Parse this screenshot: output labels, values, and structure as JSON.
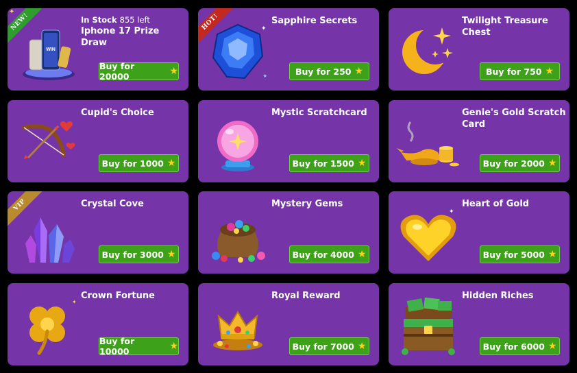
{
  "star_glyph": "★",
  "colors": {
    "card": "#7535a8",
    "button": "#3ea11a",
    "background": "#000000"
  },
  "cards": [
    {
      "title": "Iphone 17 Prize Draw",
      "stock_label": "In Stock",
      "stock_count": "855 left",
      "buy": "Buy for 20000",
      "badge": "NEW!",
      "icon": "iphone-prize-icon"
    },
    {
      "title": "Sapphire Secrets",
      "buy": "Buy for 250",
      "badge": "HOT!",
      "icon": "sapphire-gem-icon"
    },
    {
      "title": "Twilight Treasure Chest",
      "buy": "Buy for 750",
      "icon": "crescent-moon-icon"
    },
    {
      "title": "Cupid's Choice",
      "buy": "Buy for 1000",
      "icon": "bow-arrow-icon"
    },
    {
      "title": "Mystic Scratchcard",
      "buy": "Buy for 1500",
      "icon": "crystal-ball-icon"
    },
    {
      "title": "Genie's Gold Scratch Card",
      "buy": "Buy for 2000",
      "icon": "genie-lamp-icon"
    },
    {
      "title": "Crystal Cove",
      "buy": "Buy for 3000",
      "badge": "VIP",
      "icon": "crystal-cluster-icon"
    },
    {
      "title": "Mystery Gems",
      "buy": "Buy for 4000",
      "icon": "gem-sack-icon"
    },
    {
      "title": "Heart of Gold",
      "buy": "Buy for 5000",
      "icon": "gold-heart-icon"
    },
    {
      "title": "Crown Fortune",
      "buy": "Buy for 10000",
      "icon": "gold-clover-icon"
    },
    {
      "title": "Royal Reward",
      "buy": "Buy for 7000",
      "icon": "crown-icon"
    },
    {
      "title": "Hidden Riches",
      "buy": "Buy for 6000",
      "icon": "treasure-chest-icon"
    }
  ]
}
